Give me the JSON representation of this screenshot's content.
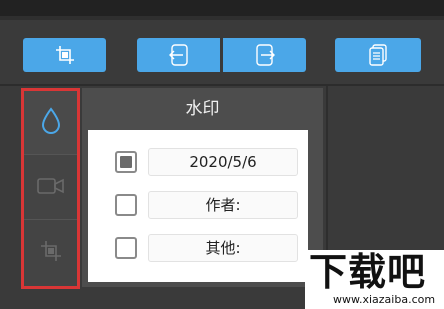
{
  "toolbar": {
    "buttons": [
      {
        "icon": "crop-icon"
      },
      {
        "icon": "arrow-left-box-icon"
      },
      {
        "icon": "arrow-right-box-icon"
      },
      {
        "icon": "pages-icon"
      }
    ],
    "accent": "#4ba7e8"
  },
  "sidebar": {
    "items": [
      {
        "icon": "drop-icon",
        "active": true
      },
      {
        "icon": "video-camera-icon",
        "active": false
      },
      {
        "icon": "crop-frame-icon",
        "active": false
      }
    ],
    "highlight_color": "#d93636"
  },
  "watermark_panel": {
    "title": "水印",
    "rows": [
      {
        "checked": true,
        "value": "2020/5/6"
      },
      {
        "checked": false,
        "value": "作者:"
      },
      {
        "checked": false,
        "value": "其他:"
      }
    ]
  },
  "watermark_logo": {
    "text": "下载吧",
    "url": "www.xiazaiba.com"
  }
}
